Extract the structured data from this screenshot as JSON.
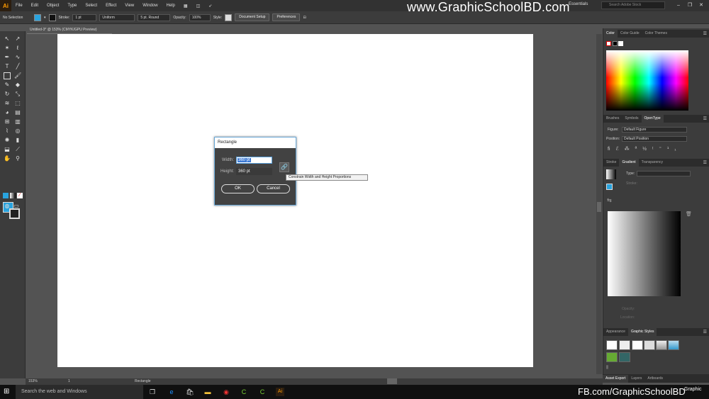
{
  "app": {
    "logo": "Ai"
  },
  "menu": [
    "File",
    "Edit",
    "Object",
    "Type",
    "Select",
    "Effect",
    "View",
    "Window",
    "Help"
  ],
  "watermark_top": "www.GraphicSchoolBD.com",
  "workspace": "Essentials",
  "search_stock_placeholder": "Search Adobe Stock",
  "window_controls": {
    "minimize": "–",
    "restore": "❐",
    "close": "✕"
  },
  "control": {
    "selection": "No Selection",
    "stroke_label": "Stroke:",
    "stroke_value": "1 pt",
    "uniform": "Uniform",
    "brush": "5 pt. Round",
    "opacity_label": "Opacity:",
    "opacity_value": "100%",
    "style_label": "Style:",
    "doc_setup": "Document Setup",
    "preferences": "Preferences"
  },
  "doc_tab": "Untitled-3* @ 153% (CMYK/GPU Preview)",
  "dialog": {
    "title": "Rectangle",
    "width_label": "Width:",
    "width_value": "360 pt",
    "height_label": "Height:",
    "height_value": "360 pt",
    "ok": "OK",
    "cancel": "Cancel",
    "link_icon": "🔗"
  },
  "tooltip": "Constrain Width and Height Proportions",
  "status": {
    "zoom": "153%",
    "page": "1",
    "tool": "Rectangle"
  },
  "panels": {
    "color_tabs": [
      "Color",
      "Color Guide",
      "Color Themes"
    ],
    "type_tabs": [
      "Brushes",
      "Symbols",
      "OpenType"
    ],
    "figure_label": "Figure:",
    "figure_value": "Default Figure",
    "position_label": "Position:",
    "position_value": "Default Position",
    "gradient_tabs": [
      "Stroke",
      "Gradient",
      "Transparency"
    ],
    "type_label": "Type:",
    "stroke_label": "Stroke:",
    "opacity_label": "Opacity:",
    "location_label": "Location:",
    "graphic_tabs": [
      "Appearance",
      "Graphic Styles"
    ],
    "bottom_tabs": [
      "Asset Export",
      "Layers",
      "Artboards"
    ]
  },
  "taskbar": {
    "search": "Search the web and Windows",
    "fb": "FB.com/GraphicSchoolBD",
    "logo": "Graphic"
  },
  "colors": {
    "fill": "#29a3de",
    "accent": "#6aa9d8",
    "selection": "#3a78d4"
  }
}
